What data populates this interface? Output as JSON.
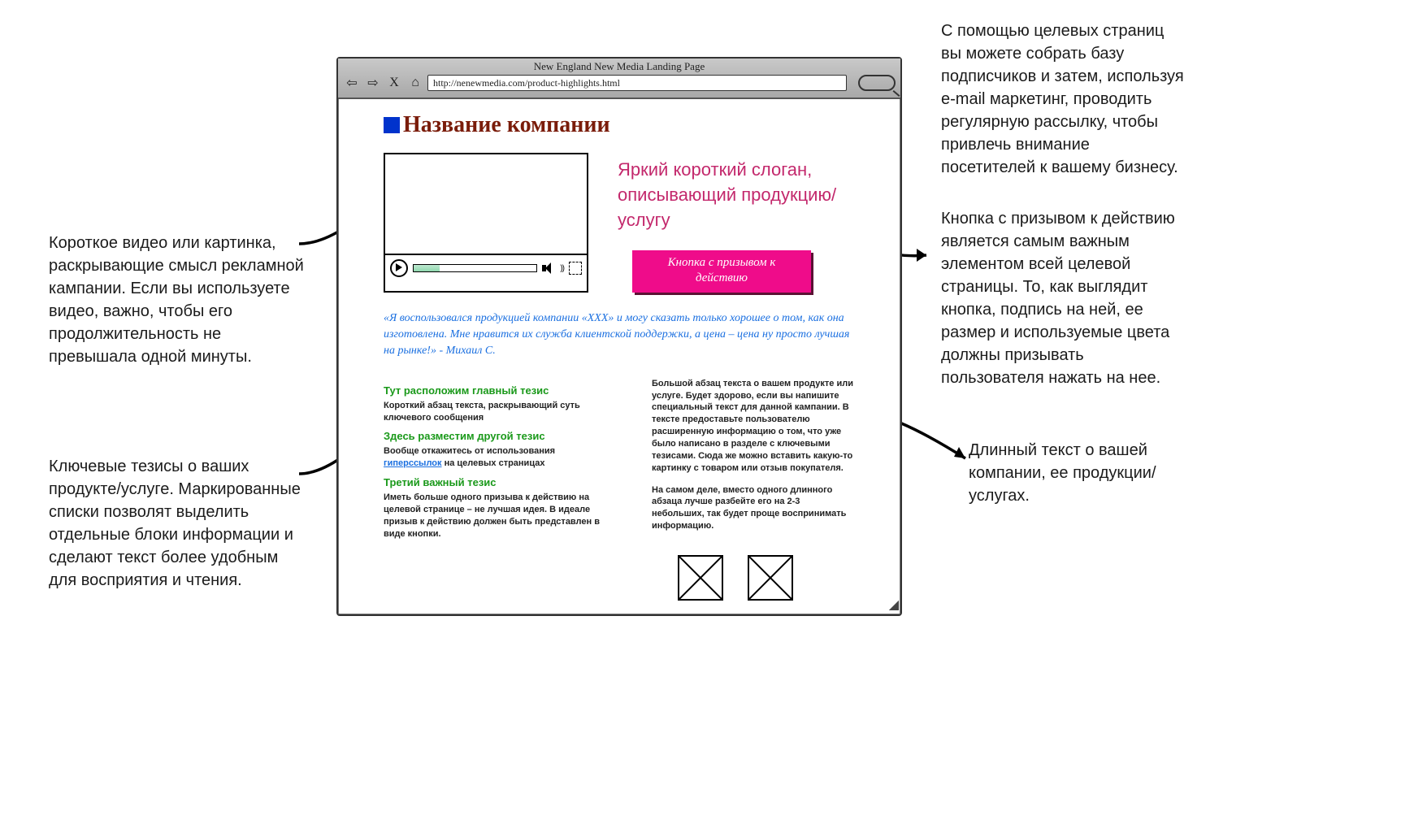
{
  "annotations": {
    "email_marketing": "С помощью целевых страниц вы можете собрать базу подписчиков и затем, используя e-mail маркетинг, проводить регулярную рассылку, чтобы привлечь внимание посетителей к вашему бизнесу.",
    "video": "Короткое видео или картинка, раскрывающие смысл рекламной кампании. Если вы используете видео, важно, чтобы его продолжительность не превышала одной минуты.",
    "cta": "Кнопка с призывом к действию является самым важным элементом всей целевой страницы. То, как выглядит кнопка, подпись на ней, ее размер и используемые цвета должны призывать пользователя нажать на нее.",
    "bullets": "Ключевые тезисы о ваших продукте/услуге. Маркированные списки позволят выделить отдельные блоки информации и сделают текст более удобным для восприятия и чтения.",
    "longtext": "Длинный текст о вашей компании, ее продукции/ услугах."
  },
  "browser": {
    "title": "New England New Media Landing Page",
    "url": "http://nenewmedia.com/product-highlights.html"
  },
  "page": {
    "company_name": "Название компании",
    "slogan": "Яркий короткий слоган, описывающий продукцию/услугу",
    "cta_label": "Кнопка с призывом к действию",
    "quote": "«Я воспользовался продукцией компании «XXX» и могу сказать только хорошее о том, как она изготовлена. Мне нравится их служба клиентской поддержки, а цена – цена ну просто лучшая на рынке!» - Михаил С.",
    "tezis": [
      {
        "h": "Тут расположим главный тезис",
        "p": "Короткий абзац текста, раскрывающий суть ключевого сообщения"
      },
      {
        "h": "Здесь разместим другой тезис",
        "p_pre": "Вообще откажитесь от использования ",
        "link": "гиперссылок",
        "p_post": " на целевых страницах"
      },
      {
        "h": "Третий важный тезис",
        "p": "Иметь больше одного призыва к действию на целевой странице – не лучшая идея. В идеале призыв к действию должен быть представлен в виде кнопки."
      }
    ],
    "right_paras": [
      "Большой абзац текста о вашем продукте или услуге. Будет здорово, если вы напишите специальный текст для данной кампании. В тексте предоставьте пользователю расширенную информацию о том, что уже было написано в разделе с ключевыми тезисами. Сюда же можно вставить какую-то картинку с товаром или отзыв покупателя.",
      "На самом деле, вместо одного длинного абзаца лучше разбейте его на 2-3 небольших, так будет проще воспринимать информацию."
    ]
  }
}
